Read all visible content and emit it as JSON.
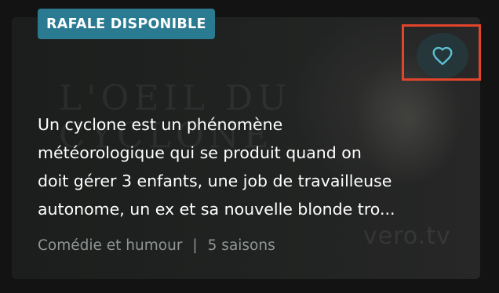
{
  "card": {
    "badge": "RAFALE DISPONIBLE",
    "description_lines": [
      "Un cyclone est un phénomène",
      "météorologique qui se produit quand on",
      "doit gérer 3 enfants, une job de travailleuse",
      "autonome, un ex et sa nouvelle blonde tro..."
    ],
    "genre": "Comédie et humour",
    "separator": "|",
    "seasons": "5 saisons",
    "background_title_line1": "L'OEIL DU",
    "background_title_line2": "CYCLONE",
    "watermark": "vero.tv",
    "favorite_icon": "heart-outline-icon"
  },
  "colors": {
    "page_background": "#131313",
    "badge_background": "#2a7a91",
    "heart_stroke": "#5cc1d4",
    "highlight_border": "#e2442c",
    "meta_text": "#8f9594"
  }
}
